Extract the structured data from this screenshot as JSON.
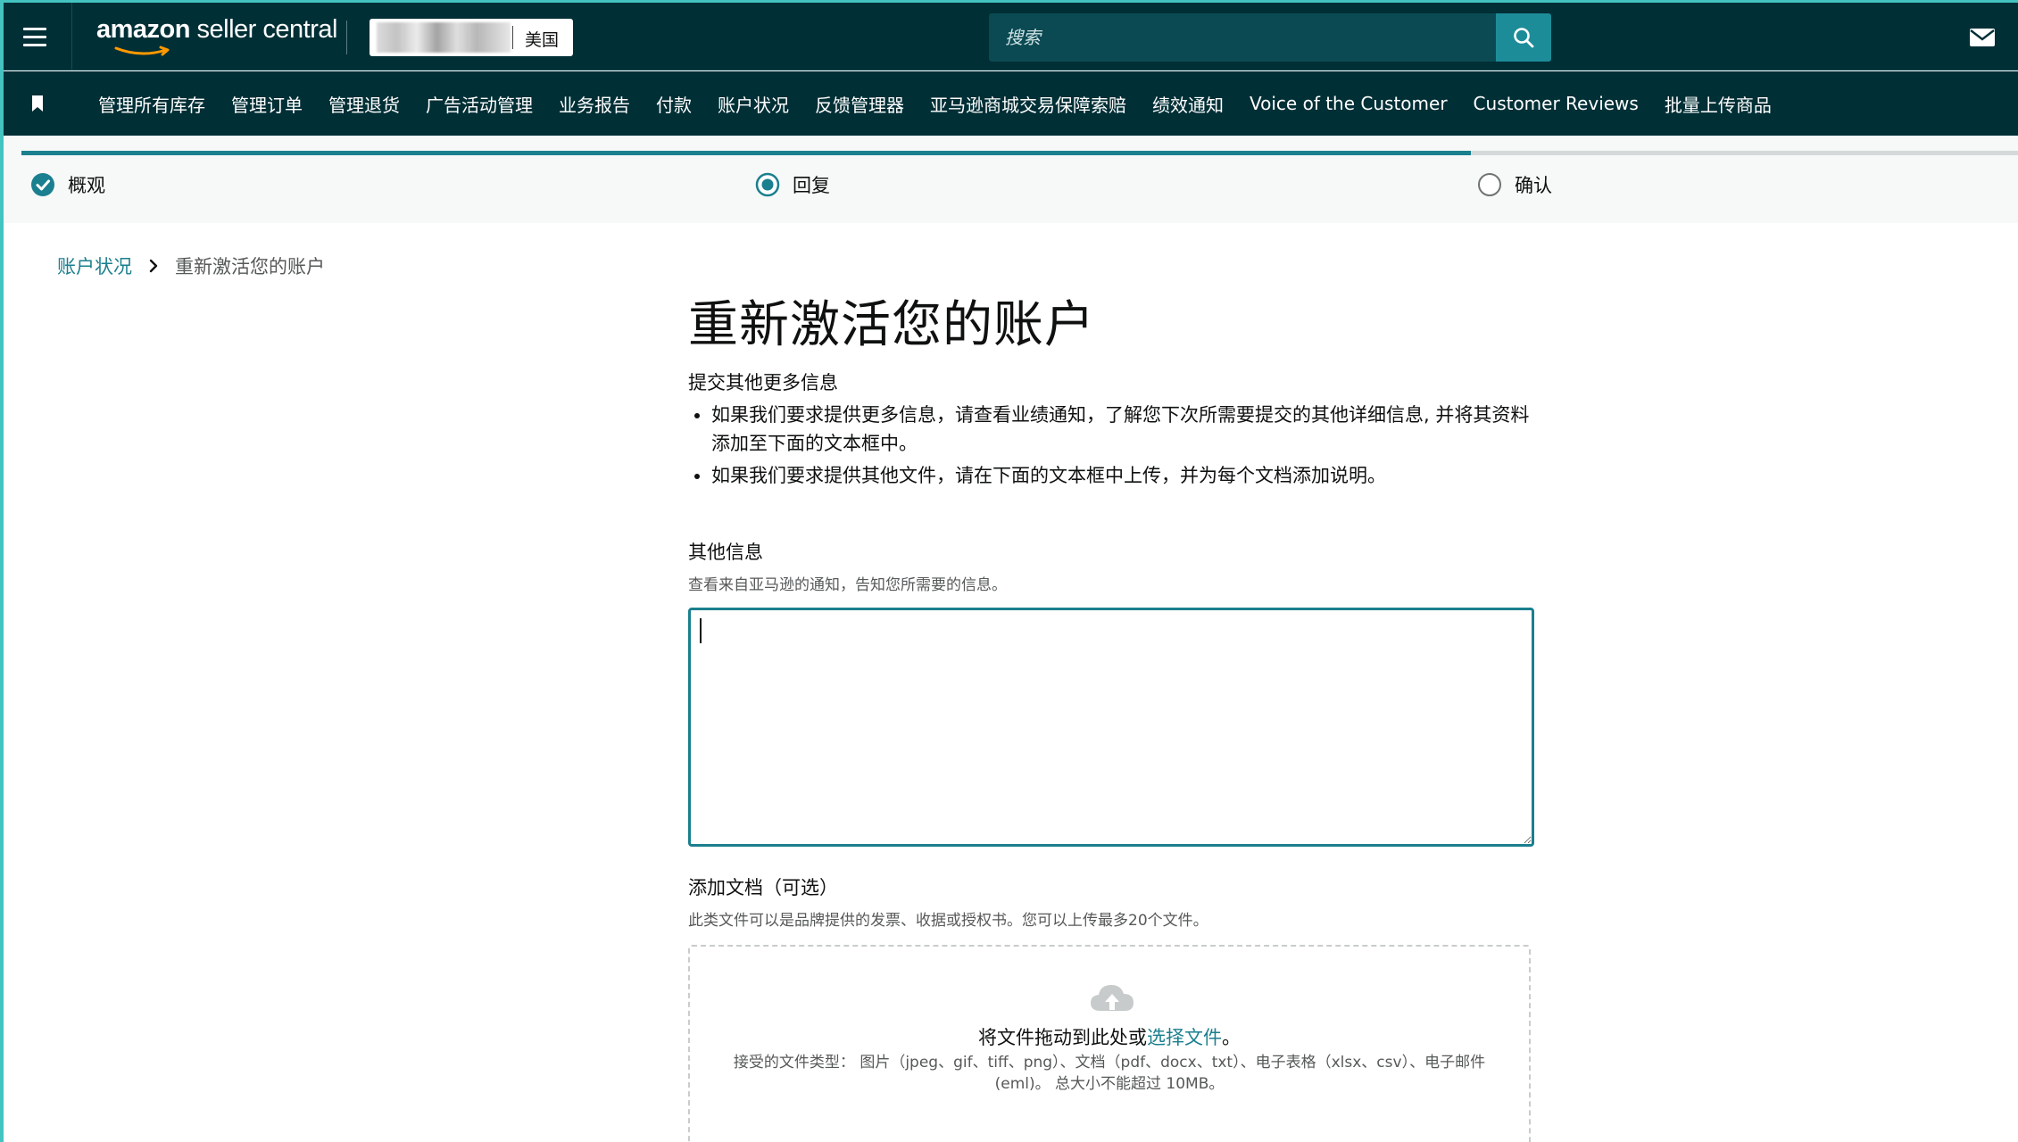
{
  "header": {
    "logo_brand": "amazon",
    "logo_rest": " seller central",
    "store_region": "美国",
    "search_placeholder": "搜索"
  },
  "nav": {
    "items": [
      "管理所有库存",
      "管理订单",
      "管理退货",
      "广告活动管理",
      "业务报告",
      "付款",
      "账户状况",
      "反馈管理器",
      "亚马逊商城交易保障索赔",
      "绩效通知",
      "Voice of the Customer",
      "Customer Reviews",
      "批量上传商品"
    ]
  },
  "progress": {
    "steps": [
      {
        "label": "概观",
        "state": "completed"
      },
      {
        "label": "回复",
        "state": "current"
      },
      {
        "label": "确认",
        "state": "pending"
      }
    ]
  },
  "breadcrumb": {
    "parent": "账户状况",
    "current": "重新激活您的账户"
  },
  "main": {
    "title": "重新激活您的账户",
    "subtitle": "提交其他更多信息",
    "bullets": [
      "如果我们要求提供更多信息，请查看业绩通知，了解您下次所需要提交的其他详细信息, 并将其资料添加至下面的文本框中。",
      "如果我们要求提供其他文件，请在下面的文本框中上传，并为每个文档添加说明。"
    ],
    "other_info_label": "其他信息",
    "other_info_help": "查看来自亚马逊的通知，告知您所需要的信息。",
    "other_info_value": "",
    "docs_label": "添加文档（可选）",
    "docs_help": "此类文件可以是品牌提供的发票、收据或授权书。您可以上传最多20个文件。",
    "drop_text": "将文件拖动到此处或",
    "drop_link": "选择文件",
    "drop_end": "。",
    "drop_types": "接受的文件类型： 图片（jpeg、gif、tiff、png）、文档（pdf、docx、txt）、电子表格（xlsx、csv）、电子邮件 (eml)。 总大小不能超过 10MB。"
  },
  "colors": {
    "header_bg": "#002f36",
    "accent": "#1a7f8e",
    "frame_border": "#44c4c1"
  }
}
